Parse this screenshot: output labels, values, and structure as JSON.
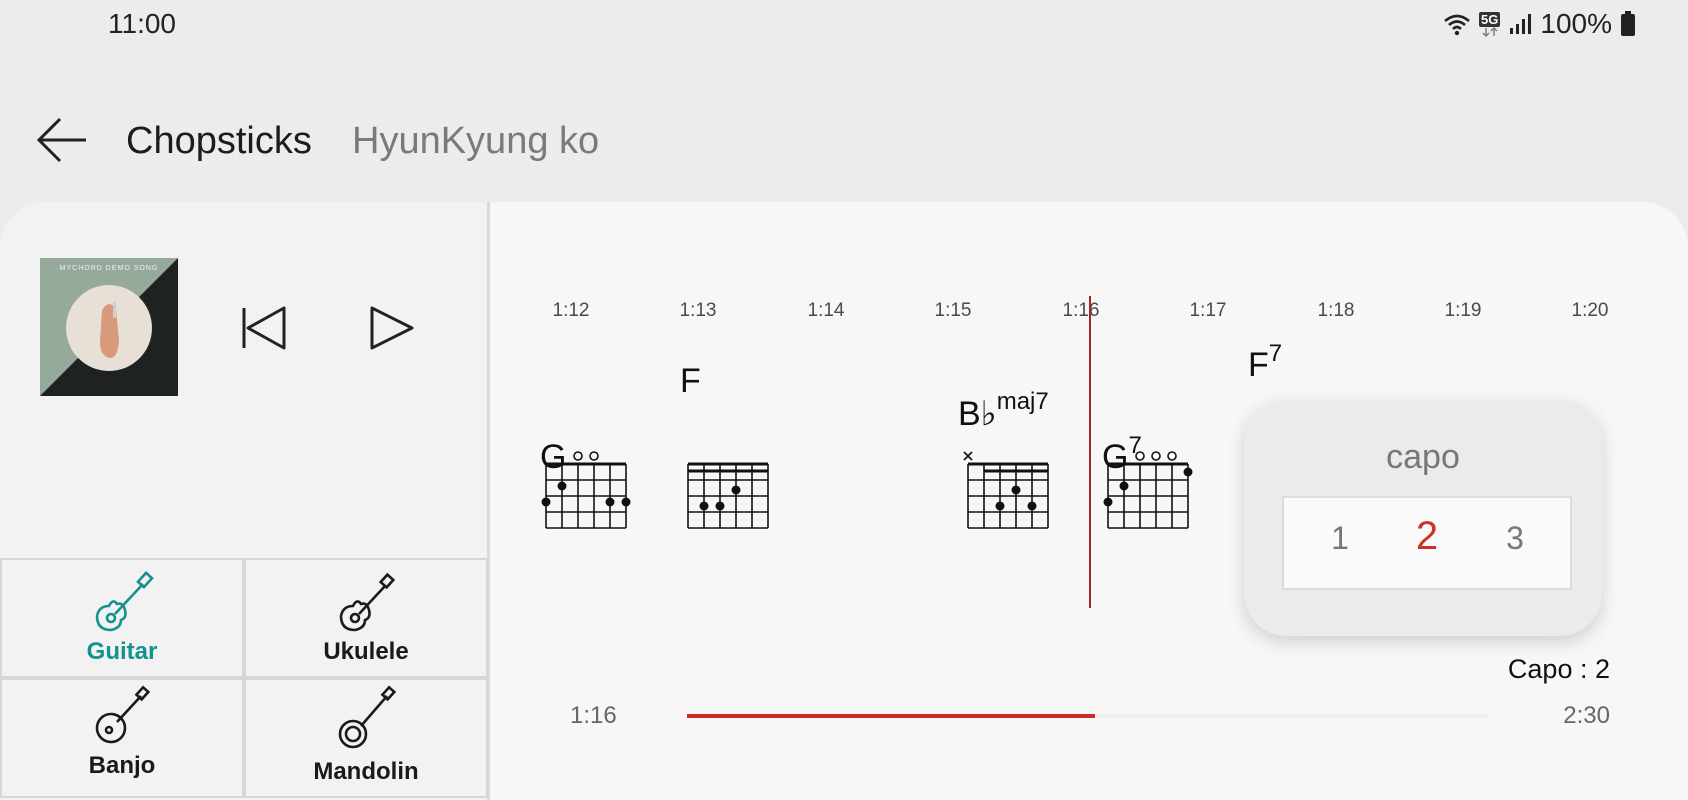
{
  "status_bar": {
    "time": "11:00",
    "network": "5G",
    "battery": "100%",
    "icons": [
      "wifi-icon",
      "network-5g-icon",
      "signal-icon",
      "battery-icon"
    ]
  },
  "header": {
    "back_icon": "arrow-left-icon",
    "title": "Chopsticks",
    "artist": "HyunKyung ko"
  },
  "player": {
    "album_art_text": "MYCHORD DEMO SONG",
    "prev_icon": "skip-previous-icon",
    "play_icon": "play-icon"
  },
  "instruments": [
    {
      "label": "Guitar",
      "icon": "guitar-icon",
      "active": true
    },
    {
      "label": "Ukulele",
      "icon": "ukulele-icon",
      "active": false
    },
    {
      "label": "Banjo",
      "icon": "banjo-icon",
      "active": false
    },
    {
      "label": "Mandolin",
      "icon": "mandolin-icon",
      "active": false
    }
  ],
  "timeline": {
    "ticks": [
      "1:12",
      "1:13",
      "1:14",
      "1:15",
      "1:16",
      "1:17",
      "1:18",
      "1:19",
      "1:20"
    ],
    "chords": [
      {
        "root": "G",
        "quality": ""
      },
      {
        "root": "F",
        "quality": ""
      },
      {
        "root": "B♭",
        "quality": "maj7"
      },
      {
        "root": "G",
        "quality": "7"
      },
      {
        "root": "F",
        "quality": "7"
      }
    ]
  },
  "capo": {
    "title": "capo",
    "options": [
      "1",
      "2",
      "3"
    ],
    "selected": "2",
    "status": "Capo : 2"
  },
  "progress": {
    "current": "1:16",
    "total": "2:30",
    "fraction": 0.51
  },
  "colors": {
    "accent_teal": "#14928e",
    "accent_red": "#cc2e22",
    "playhead": "#a32424"
  }
}
